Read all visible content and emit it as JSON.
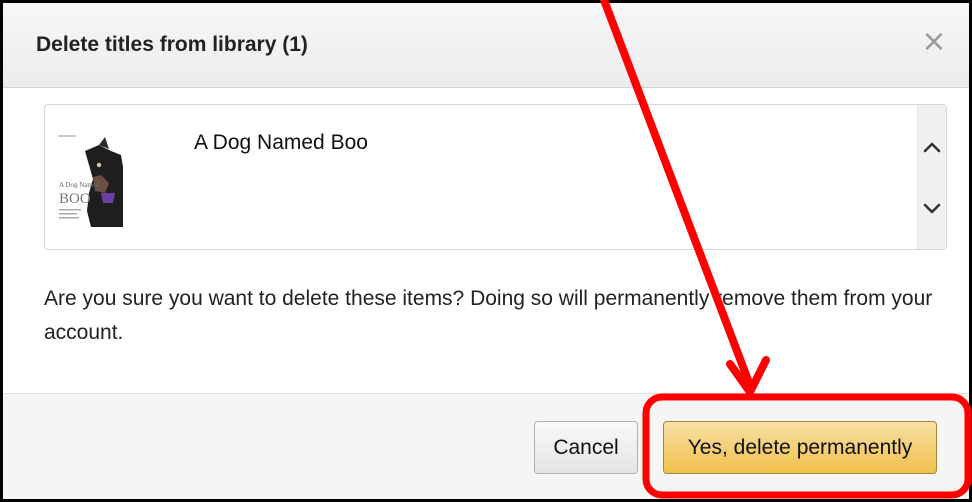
{
  "dialog": {
    "title": "Delete titles from library (1)",
    "close_icon": "close-icon",
    "items": [
      {
        "title": "A Dog Named Boo",
        "cover_text": "BOO"
      }
    ],
    "scroll_up_icon": "chevron-up-icon",
    "scroll_down_icon": "chevron-down-icon",
    "message": "Are you sure you want to delete these items? Doing so will permanently remove them from your account.",
    "buttons": {
      "cancel_label": "Cancel",
      "confirm_label": "Yes, delete permanently"
    }
  },
  "annotation": {
    "color": "#ff0000",
    "arrow_icon": "red-arrow-annotation",
    "highlight": "red-rounded-rectangle-highlight"
  },
  "colors": {
    "primary_button": "#f0c14b",
    "header_bg": "#f2f2f2",
    "footer_bg": "#f5f5f5"
  }
}
